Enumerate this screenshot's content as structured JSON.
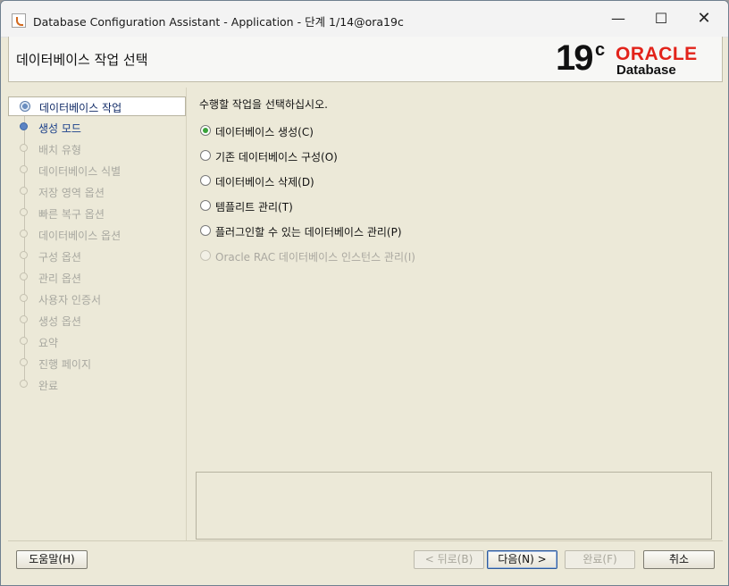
{
  "window": {
    "title": "Database Configuration Assistant - Application - 단계 1/14@ora19c",
    "minimize_icon": "—",
    "maximize_icon": "☐",
    "close_icon": "✕"
  },
  "header": {
    "title": "데이터베이스 작업 선택",
    "logo": {
      "version": "19",
      "version_suffix": "c",
      "brand": "ORACLE",
      "product": "Database",
      "brand_color": "#e2231a"
    }
  },
  "nav": {
    "items": [
      {
        "label": "데이터베이스 작업",
        "state": "current"
      },
      {
        "label": "생성 모드",
        "state": "next"
      },
      {
        "label": "배치 유형",
        "state": "disabled"
      },
      {
        "label": "데이터베이스 식별",
        "state": "disabled"
      },
      {
        "label": "저장 영역 옵션",
        "state": "disabled"
      },
      {
        "label": "빠른 복구 옵션",
        "state": "disabled"
      },
      {
        "label": "데이터베이스 옵션",
        "state": "disabled"
      },
      {
        "label": "구성 옵션",
        "state": "disabled"
      },
      {
        "label": "관리 옵션",
        "state": "disabled"
      },
      {
        "label": "사용자 인증서",
        "state": "disabled"
      },
      {
        "label": "생성 옵션",
        "state": "disabled"
      },
      {
        "label": "요약",
        "state": "disabled"
      },
      {
        "label": "진행 페이지",
        "state": "disabled"
      },
      {
        "label": "완료",
        "state": "disabled"
      }
    ]
  },
  "content": {
    "prompt": "수행할 작업을 선택하십시오.",
    "options": [
      {
        "label": "데이터베이스 생성(C)",
        "checked": true,
        "enabled": true
      },
      {
        "label": "기존 데이터베이스 구성(O)",
        "checked": false,
        "enabled": true
      },
      {
        "label": "데이터베이스 삭제(D)",
        "checked": false,
        "enabled": true
      },
      {
        "label": "템플리트 관리(T)",
        "checked": false,
        "enabled": true
      },
      {
        "label": "플러그인할 수 있는 데이터베이스 관리(P)",
        "checked": false,
        "enabled": true
      },
      {
        "label": "Oracle RAC 데이터베이스 인스턴스 관리(I)",
        "checked": false,
        "enabled": false
      }
    ]
  },
  "footer": {
    "help_label": "도움말(H)",
    "back_label": "< 뒤로(B)",
    "next_label": "다음(N) >",
    "finish_label": "완료(F)",
    "cancel_label": "취소"
  }
}
